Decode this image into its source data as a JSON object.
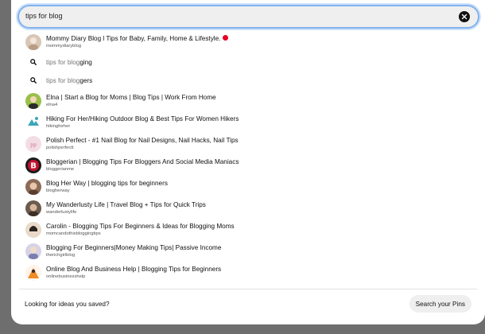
{
  "search": {
    "value": "tips for blog"
  },
  "suggestions": [
    {
      "type": "profile",
      "title": "Mommy Diary Blog l Tips for Baby, Family, Home & Lifestyle.",
      "handle": "mommydiaryblog",
      "verified": true,
      "avatar_color": "#d9c7b6"
    },
    {
      "type": "query",
      "prefix": "tips for blog",
      "suffix": "ging"
    },
    {
      "type": "query",
      "prefix": "tips for blog",
      "suffix": "gers"
    },
    {
      "type": "profile",
      "title": "Elna | Start a Blog for Moms | Blog Tips | Work From Home",
      "handle": "elna4",
      "avatar_color": "#9bbf4a"
    },
    {
      "type": "profile",
      "title": "Hiking For Her/Hiking Outdoor Blog & Best Tips For Women Hikers",
      "handle": "hikingforher",
      "avatar_color": "#3aa6b9"
    },
    {
      "type": "profile",
      "title": "Polish Perfect - #1 Nail Blog for Nail Designs, Nail Hacks, Nail Tips",
      "handle": "polishperfectt",
      "avatar_color": "#f3dde4"
    },
    {
      "type": "profile",
      "title": "Bloggerian | Blogging Tips For Bloggers And Social Media Maniacs",
      "handle": "bloggerianme",
      "avatar_color": "#1b1b1b"
    },
    {
      "type": "profile",
      "title": "Blog Her Way | blogging tips for beginners",
      "handle": "blogherway",
      "avatar_color": "#8c6a58"
    },
    {
      "type": "profile",
      "title": "My Wanderlusty Life | Travel Blog + Tips for Quick Trips",
      "handle": "wanderlustylife",
      "avatar_color": "#6b5a4e"
    },
    {
      "type": "profile",
      "title": "Carolin - Blogging Tips For Beginners & Ideas for Blogging Moms",
      "handle": "momcandothisbloggingtips",
      "avatar_color": "#e9d9c9"
    },
    {
      "type": "profile",
      "title": "Blogging For Beginners|Money Making Tips| Passive Income",
      "handle": "therichgirlblog",
      "avatar_color": "#d8d2e6"
    },
    {
      "type": "profile",
      "title": "Online Blog And Business Help | Blogging Tips for Beginners",
      "handle": "onlinebusinesshelp",
      "avatar_color": "#f08a24"
    }
  ],
  "footer": {
    "prompt": "Looking for ideas you saved?",
    "button_label": "Search your Pins"
  },
  "colors": {
    "accent_border": "#7fb3ee",
    "verified_badge": "#e60023",
    "backdrop": "#6e6e6e"
  }
}
